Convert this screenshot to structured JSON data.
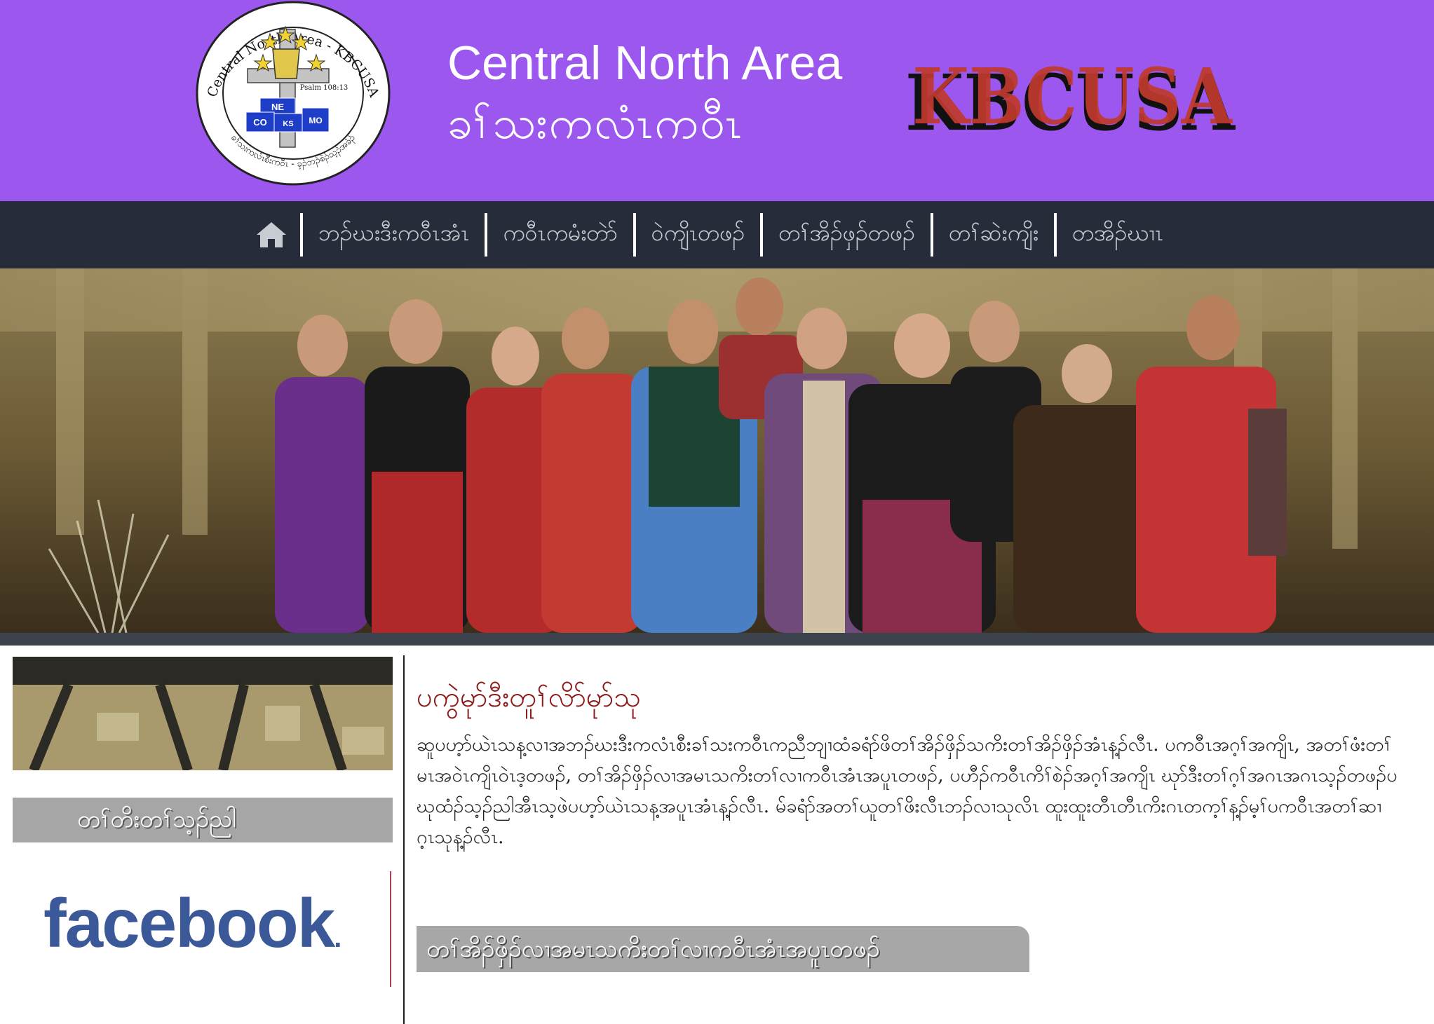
{
  "header": {
    "title_en": "Central North Area",
    "title_karen": "ခၢ်သးကလံၤကဝီၤ",
    "kbc_logo_text": "KBCUSA",
    "colors": {
      "background": "#9b57ee",
      "logo_red": "#c0392b",
      "logo_black": "#111111"
    },
    "seal": {
      "top_ring_text": "Central North Area - KBCUSA",
      "bottom_ring_text": "ခၢ်သးကလံၤစီးကဝီၤ - ခ့ၣ်ဘၣ်စဲၣ်သ့ၣ်အခံၣ်",
      "verse": "Psalm 108:13",
      "states": [
        "NE",
        "CO",
        "KS",
        "MO"
      ]
    }
  },
  "nav": {
    "home_icon": "home-icon",
    "items": [
      {
        "label": "ဘၣ်ဃးဒီးကဝီၤအံၤ"
      },
      {
        "label": "ကဝီၤကမံးတဲာ်"
      },
      {
        "label": "ဝဲကျိၤတဖၣ်"
      },
      {
        "label": "တၢ်အိၣ်ဖှၣ်တဖၣ်"
      },
      {
        "label": "တၢ်ဆဲးကျိး"
      },
      {
        "label": "တအိၣ်ဃၢၤ"
      }
    ]
  },
  "sidebar": {
    "heading": "တၢ်တိးတၢ်သ့ၣ်ညါ",
    "facebook_logo": "facebook"
  },
  "main": {
    "title": "ပကွဲမုာ်ဒီးတူၢ်လိာ်မုာ်သု",
    "body": "ဆူပဟ့ာ်ယဲၤသန့လၢအဘၣ်ဃးဒီးကလံၤစီးခၢ်သးကဝီၤကညီဘျၢထံခရံာ်ဖိတၢ်အိၣ်ဖှိၣ်သကိးတၢ်အိၣ်ဖှိၣ်အံၤန့ၣ်လီၤ. ပကဝီၤအဂ့ၢ်အကျိၤ, အတၢ်ဖံးတၢ်မၤအဝဲၤကျိၤဝဲၤဒ့တဖၣ်, တၢ်အိၣ်ဖှိၣ်လၢအမၤသကိးတၢ်လၢကဝီၤအံၤအပူၤတဖၣ်, ပဟီၣ်ကဝီၤကိၢ်စဲၣ်အဂ့ၢ်အကျိၤ ဃုာ်ဒီးတၢ်ဂ့ၢ်အဂၤအဂၤသ့ၣ်တဖၣ်ပဃုထံၣ်သ့ၣ်ညါအီၤသ့ဖဲပဟ့ာ်ယဲၤသန့အပူၤအံၤန့ၣ်လီၤ. မ်ခရံာ်အတၢ်ယူတၢ်ဖိးလီၤဘၣ်လၢသုလိၤ ထူးထူးတီၤတီၤကိးဂၤတက့ၢ်န့ၣ်မ့ၢ်ပကဝီၤအတၢ်ဆၢဂ့ၤသုန့ၣ်လီၤ.",
    "tab_label": "တၢ်အိၣ်ဖှိၣ်လၢအမၤသကိးတၢ်လၢကဝီၤအံၤအပူၤတဖၣ်"
  }
}
